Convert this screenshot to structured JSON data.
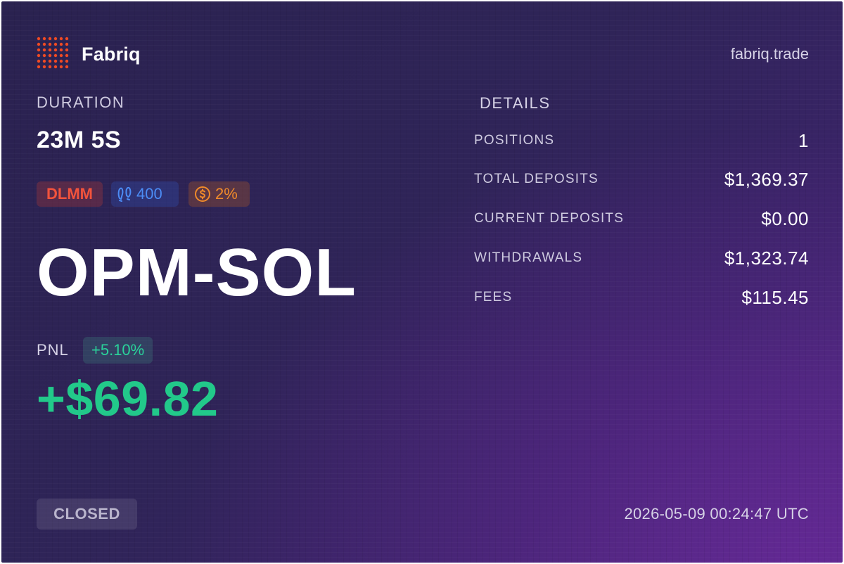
{
  "header": {
    "brand": "Fabriq",
    "site": "fabriq.trade"
  },
  "duration": {
    "label": "DURATION",
    "value": "23M 5S"
  },
  "tags": {
    "pool_type": "DLMM",
    "bin_step": "400",
    "fee": "2%"
  },
  "pair": "OPM-SOL",
  "pnl": {
    "label": "PNL",
    "percent": "+5.10%",
    "value": "+$69.82"
  },
  "status": "CLOSED",
  "details": {
    "label": "DETAILS",
    "rows": [
      {
        "key": "POSITIONS",
        "value": "1"
      },
      {
        "key": "TOTAL DEPOSITS",
        "value": "$1,369.37"
      },
      {
        "key": "CURRENT DEPOSITS",
        "value": "$0.00"
      },
      {
        "key": "WITHDRAWALS",
        "value": "$1,323.74"
      },
      {
        "key": "FEES",
        "value": "$115.45"
      }
    ]
  },
  "timestamp": "2026-05-09 00:24:47 UTC",
  "colors": {
    "accent_orange": "#f2533c",
    "pnl_green": "#22c98a",
    "bin_blue": "#4c8cf5",
    "fee_orange": "#f08a2a"
  },
  "icons": {
    "logo": "fabriq-dot-grid-logo",
    "bin_step": "footprints-icon",
    "fee": "dollar-coin-icon"
  }
}
